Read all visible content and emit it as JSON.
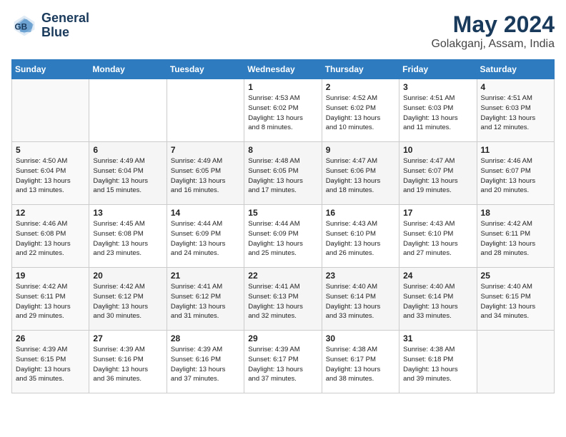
{
  "logo": {
    "line1": "General",
    "line2": "Blue"
  },
  "title": "May 2024",
  "subtitle": "Golakganj, Assam, India",
  "weekdays": [
    "Sunday",
    "Monday",
    "Tuesday",
    "Wednesday",
    "Thursday",
    "Friday",
    "Saturday"
  ],
  "weeks": [
    [
      {
        "day": "",
        "info": ""
      },
      {
        "day": "",
        "info": ""
      },
      {
        "day": "",
        "info": ""
      },
      {
        "day": "1",
        "info": "Sunrise: 4:53 AM\nSunset: 6:02 PM\nDaylight: 13 hours\nand 8 minutes."
      },
      {
        "day": "2",
        "info": "Sunrise: 4:52 AM\nSunset: 6:02 PM\nDaylight: 13 hours\nand 10 minutes."
      },
      {
        "day": "3",
        "info": "Sunrise: 4:51 AM\nSunset: 6:03 PM\nDaylight: 13 hours\nand 11 minutes."
      },
      {
        "day": "4",
        "info": "Sunrise: 4:51 AM\nSunset: 6:03 PM\nDaylight: 13 hours\nand 12 minutes."
      }
    ],
    [
      {
        "day": "5",
        "info": "Sunrise: 4:50 AM\nSunset: 6:04 PM\nDaylight: 13 hours\nand 13 minutes."
      },
      {
        "day": "6",
        "info": "Sunrise: 4:49 AM\nSunset: 6:04 PM\nDaylight: 13 hours\nand 15 minutes."
      },
      {
        "day": "7",
        "info": "Sunrise: 4:49 AM\nSunset: 6:05 PM\nDaylight: 13 hours\nand 16 minutes."
      },
      {
        "day": "8",
        "info": "Sunrise: 4:48 AM\nSunset: 6:05 PM\nDaylight: 13 hours\nand 17 minutes."
      },
      {
        "day": "9",
        "info": "Sunrise: 4:47 AM\nSunset: 6:06 PM\nDaylight: 13 hours\nand 18 minutes."
      },
      {
        "day": "10",
        "info": "Sunrise: 4:47 AM\nSunset: 6:07 PM\nDaylight: 13 hours\nand 19 minutes."
      },
      {
        "day": "11",
        "info": "Sunrise: 4:46 AM\nSunset: 6:07 PM\nDaylight: 13 hours\nand 20 minutes."
      }
    ],
    [
      {
        "day": "12",
        "info": "Sunrise: 4:46 AM\nSunset: 6:08 PM\nDaylight: 13 hours\nand 22 minutes."
      },
      {
        "day": "13",
        "info": "Sunrise: 4:45 AM\nSunset: 6:08 PM\nDaylight: 13 hours\nand 23 minutes."
      },
      {
        "day": "14",
        "info": "Sunrise: 4:44 AM\nSunset: 6:09 PM\nDaylight: 13 hours\nand 24 minutes."
      },
      {
        "day": "15",
        "info": "Sunrise: 4:44 AM\nSunset: 6:09 PM\nDaylight: 13 hours\nand 25 minutes."
      },
      {
        "day": "16",
        "info": "Sunrise: 4:43 AM\nSunset: 6:10 PM\nDaylight: 13 hours\nand 26 minutes."
      },
      {
        "day": "17",
        "info": "Sunrise: 4:43 AM\nSunset: 6:10 PM\nDaylight: 13 hours\nand 27 minutes."
      },
      {
        "day": "18",
        "info": "Sunrise: 4:42 AM\nSunset: 6:11 PM\nDaylight: 13 hours\nand 28 minutes."
      }
    ],
    [
      {
        "day": "19",
        "info": "Sunrise: 4:42 AM\nSunset: 6:11 PM\nDaylight: 13 hours\nand 29 minutes."
      },
      {
        "day": "20",
        "info": "Sunrise: 4:42 AM\nSunset: 6:12 PM\nDaylight: 13 hours\nand 30 minutes."
      },
      {
        "day": "21",
        "info": "Sunrise: 4:41 AM\nSunset: 6:12 PM\nDaylight: 13 hours\nand 31 minutes."
      },
      {
        "day": "22",
        "info": "Sunrise: 4:41 AM\nSunset: 6:13 PM\nDaylight: 13 hours\nand 32 minutes."
      },
      {
        "day": "23",
        "info": "Sunrise: 4:40 AM\nSunset: 6:14 PM\nDaylight: 13 hours\nand 33 minutes."
      },
      {
        "day": "24",
        "info": "Sunrise: 4:40 AM\nSunset: 6:14 PM\nDaylight: 13 hours\nand 33 minutes."
      },
      {
        "day": "25",
        "info": "Sunrise: 4:40 AM\nSunset: 6:15 PM\nDaylight: 13 hours\nand 34 minutes."
      }
    ],
    [
      {
        "day": "26",
        "info": "Sunrise: 4:39 AM\nSunset: 6:15 PM\nDaylight: 13 hours\nand 35 minutes."
      },
      {
        "day": "27",
        "info": "Sunrise: 4:39 AM\nSunset: 6:16 PM\nDaylight: 13 hours\nand 36 minutes."
      },
      {
        "day": "28",
        "info": "Sunrise: 4:39 AM\nSunset: 6:16 PM\nDaylight: 13 hours\nand 37 minutes."
      },
      {
        "day": "29",
        "info": "Sunrise: 4:39 AM\nSunset: 6:17 PM\nDaylight: 13 hours\nand 37 minutes."
      },
      {
        "day": "30",
        "info": "Sunrise: 4:38 AM\nSunset: 6:17 PM\nDaylight: 13 hours\nand 38 minutes."
      },
      {
        "day": "31",
        "info": "Sunrise: 4:38 AM\nSunset: 6:18 PM\nDaylight: 13 hours\nand 39 minutes."
      },
      {
        "day": "",
        "info": ""
      }
    ]
  ]
}
